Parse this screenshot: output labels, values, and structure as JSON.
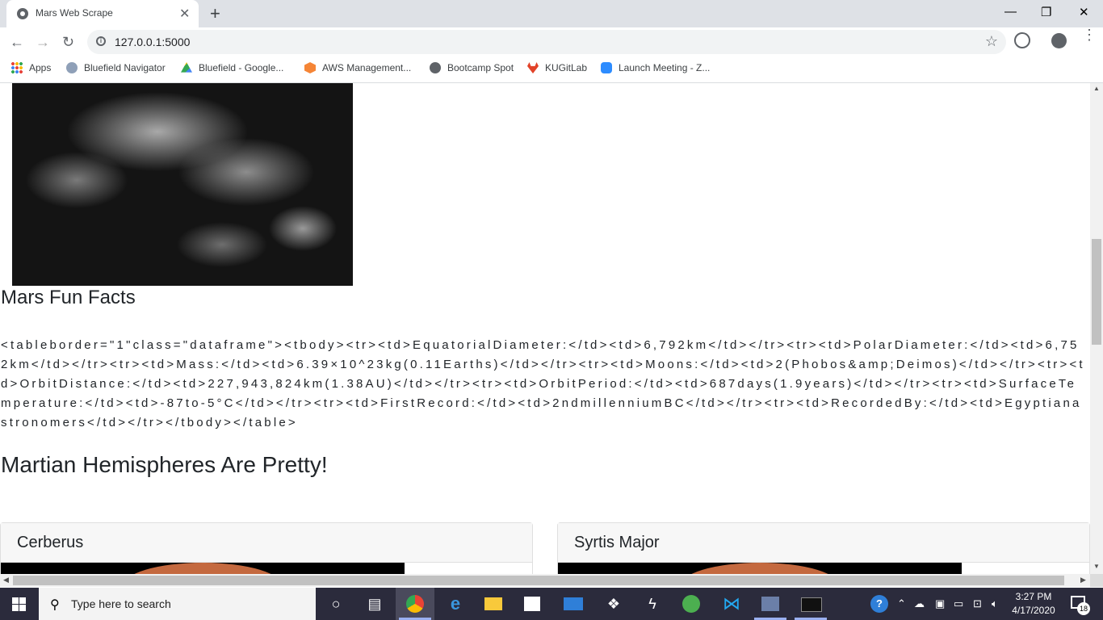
{
  "browser": {
    "tab_title": "Mars Web Scrape",
    "tab_close": "✕",
    "new_tab": "+",
    "url": "127.0.0.1:5000",
    "window_controls": {
      "minimize": "—",
      "restore": "❐",
      "close": "✕"
    },
    "nav": {
      "back": "←",
      "forward": "→",
      "reload": "↻"
    },
    "star": "☆",
    "menu": "⋮"
  },
  "bookmarks": [
    {
      "label": "Apps",
      "icon": "apps-grid-icon",
      "color": "#e8453c"
    },
    {
      "label": "Bluefield Navigator",
      "icon": "navigator-icon",
      "color": "#5b6e8c"
    },
    {
      "label": "Bluefield - Google...",
      "icon": "google-drive-icon",
      "color": "#fbbc04"
    },
    {
      "label": "AWS Management...",
      "icon": "aws-icon",
      "color": "#f58536"
    },
    {
      "label": "Bootcamp Spot",
      "icon": "globe-icon",
      "color": "#5f6368"
    },
    {
      "label": "KUGitLab",
      "icon": "gitlab-icon",
      "color": "#e24329"
    },
    {
      "label": "Launch Meeting - Z...",
      "icon": "zoom-icon",
      "color": "#2d8cff"
    }
  ],
  "page": {
    "facts_heading": "Mars Fun Facts",
    "table_html_text": "<tableborder=\"1\"class=\"dataframe\"><tbody><tr><td>EquatorialDiameter:</td><td>6,792km</td></tr><tr><td>PolarDiameter:</td><td>6,752km</td></tr><tr><td>Mass:</td><td>6.39×10^23kg(0.11Earths)</td></tr><tr><td>Moons:</td><td>2(Phobos&amp;Deimos)</td></tr><tr><td>OrbitDistance:</td><td>227,943,824km(1.38AU)</td></tr><tr><td>OrbitPeriod:</td><td>687days(1.9years)</td></tr><tr><td>SurfaceTemperature:</td><td>-87to-5°C</td></tr><tr><td>FirstRecord:</td><td>2ndmillenniumBC</td></tr><tr><td>RecordedBy:</td><td>Egyptianastronomers</td></tr></tbody></table>",
    "hemispheres_heading": "Martian Hemispheres Are Pretty!",
    "hemispheres": [
      {
        "title": "Cerberus"
      },
      {
        "title": "Syrtis Major"
      }
    ]
  },
  "taskbar": {
    "search_placeholder": "Type here to search",
    "time": "3:27 PM",
    "date": "4/17/2020",
    "notification_count": "18",
    "apps": [
      "cortana-icon",
      "task-view-icon",
      "chrome-icon",
      "edge-icon",
      "file-explorer-icon",
      "store-icon",
      "mail-icon",
      "dropbox-icon",
      "slack-like-icon",
      "globe-app-icon",
      "vscode-icon",
      "network-app-icon",
      "terminal-icon"
    ]
  }
}
